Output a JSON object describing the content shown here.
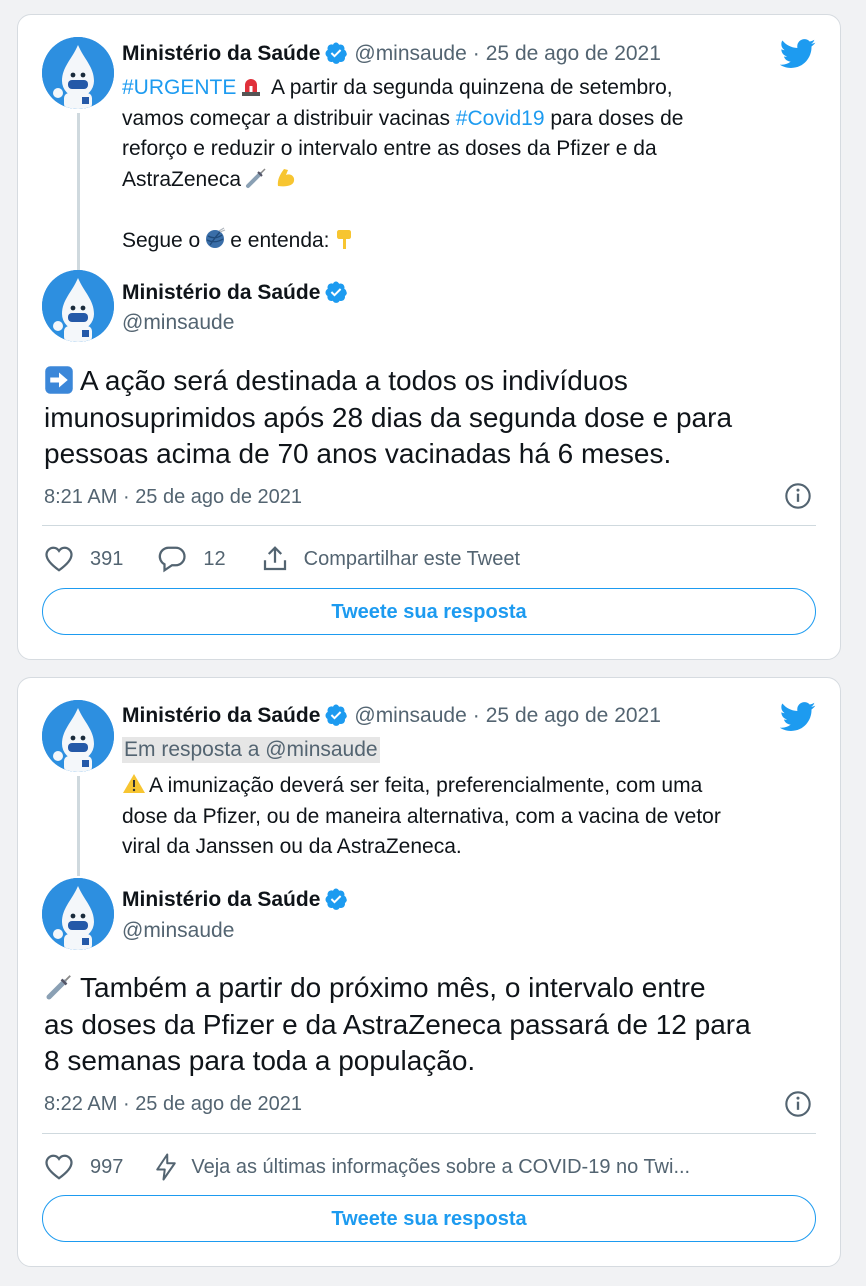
{
  "tweets": [
    {
      "quoted": {
        "name": "Ministério da Saúde",
        "handle": "@minsaude",
        "separator": "·",
        "date": "25 de ago de 2021",
        "hashtag_urgent": "#URGENTE",
        "line1_rest": " A partir da segunda quinzena de setembro,",
        "line2_pre": "vamos começar a distribuir vacinas ",
        "hashtag_covid": "#Covid19",
        "line2_post": " para doses de",
        "line3": "reforço e reduzir o intervalo entre as doses da Pfizer e da",
        "line4": "AstraZeneca",
        "line6_pre": "Segue o",
        "line6_post": "e entenda:"
      },
      "main": {
        "name": "Ministério da Saúde",
        "handle": "@minsaude",
        "line1": "A ação será destinada a todos os indivíduos",
        "line2": "imunosuprimidos após 28 dias da segunda dose e para",
        "line3": "pessoas acima de 70 anos vacinadas há 6 meses.",
        "time": "8:21 AM",
        "separator": "·",
        "date": "25 de ago de 2021"
      },
      "actions": {
        "likes": "391",
        "replies": "12",
        "share_label": "Compartilhar este Tweet"
      },
      "reply_button": "Tweete sua resposta"
    },
    {
      "quoted": {
        "name": "Ministério da Saúde",
        "handle": "@minsaude",
        "separator": "·",
        "date": "25 de ago de 2021",
        "reply_to": "Em resposta a @minsaude",
        "line1": "A imunização deverá ser feita, preferencialmente, com uma",
        "line2": "dose da Pfizer, ou de maneira alternativa, com a vacina de vetor",
        "line3": "viral da Janssen ou da AstraZeneca."
      },
      "main": {
        "name": "Ministério da Saúde",
        "handle": "@minsaude",
        "line1": "Também a partir do próximo mês, o intervalo entre",
        "line2": "as doses da Pfizer e da AstraZeneca passará de 12 para",
        "line3": "8 semanas para toda a população.",
        "time": "8:22 AM",
        "separator": "·",
        "date": "25 de ago de 2021"
      },
      "actions": {
        "likes": "997",
        "covid_label": "Veja as últimas informações sobre a COVID-19 no Twi..."
      },
      "reply_button": "Tweete sua resposta"
    }
  ],
  "colors": {
    "accent": "#1d9bf0",
    "secondary_text": "#536471",
    "primary_text": "#0f1419",
    "border": "#cfd9de",
    "background": "#f1f2f4"
  },
  "icons": [
    "twitter-bird-icon",
    "verified-badge-icon",
    "siren-emoji",
    "syringe-emoji",
    "flexed-biceps-emoji",
    "yarn-ball-emoji",
    "pointing-down-emoji",
    "right-arrow-emoji",
    "warning-emoji",
    "info-icon",
    "heart-icon",
    "reply-bubble-icon",
    "share-icon",
    "lightning-icon"
  ]
}
